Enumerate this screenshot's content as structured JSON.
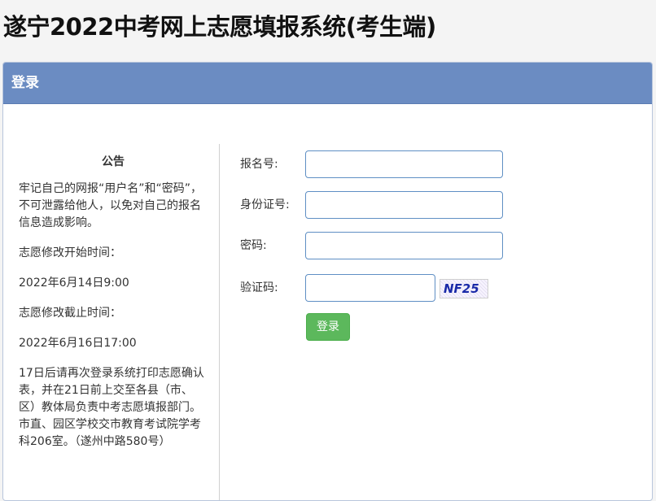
{
  "page": {
    "title": "遂宁2022中考网上志愿填报系统(考生端)"
  },
  "panel": {
    "heading": "登录"
  },
  "notice": {
    "title": "公告",
    "paragraphs": [
      "牢记自己的网报“用户名”和“密码”，不可泄露给他人，以免对自己的报名信息造成影响。",
      "志愿修改开始时间：",
      "2022年6月14日9:00",
      "志愿修改截止时间：",
      "2022年6月16日17:00",
      "17日后请再次登录系统打印志愿确认表，并在21日前上交至各县（市、区）教体局负责中考志愿填报部门。市直、园区学校交市教育考试院学考科206室。（遂州中路580号）"
    ]
  },
  "form": {
    "registration_label": "报名号:",
    "registration_value": "",
    "id_label": "身份证号:",
    "id_value": "",
    "password_label": "密码:",
    "password_value": "",
    "captcha_label": "验证码:",
    "captcha_value": "",
    "captcha_image_text": "NF25",
    "submit_label": "登录"
  },
  "colors": {
    "heading_bg": "#6b8cc2",
    "button_bg": "#5cb85c",
    "input_border": "#5f8fc4"
  }
}
